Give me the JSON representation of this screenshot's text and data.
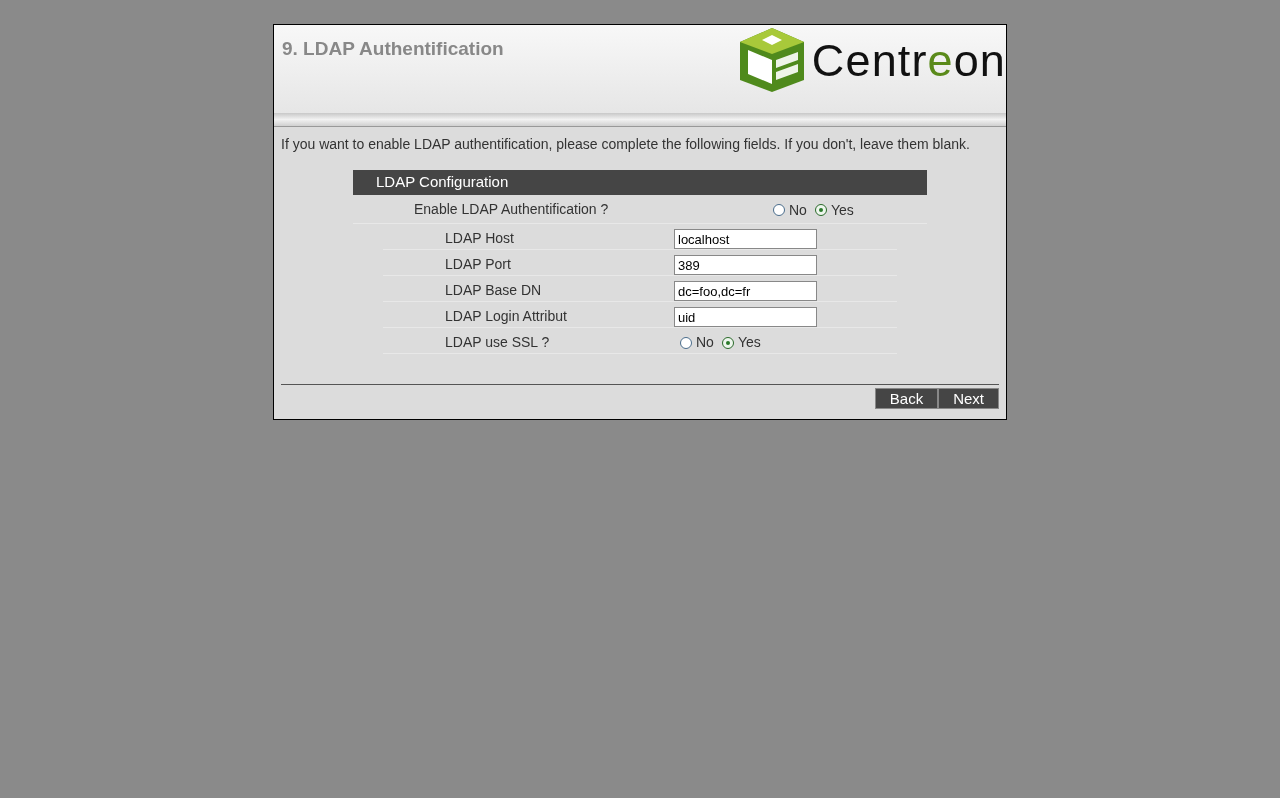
{
  "header": {
    "title": "9. LDAP Authentification",
    "logo": [
      {
        "text": "Centr",
        "color": "#111111"
      },
      {
        "text": "e",
        "color": "#5a8a1a"
      },
      {
        "text": "on",
        "color": "#111111"
      }
    ]
  },
  "intro": "If you want to enable LDAP authentification, please complete the following fields. If you don't, leave them blank.",
  "section": {
    "title": "LDAP Configuration",
    "rows": [
      {
        "kind": "radio",
        "label": "Enable LDAP Authentification ?",
        "main": true,
        "options": [
          {
            "label": "No",
            "selected": false
          },
          {
            "label": "Yes",
            "selected": true
          }
        ]
      },
      {
        "kind": "text",
        "label": "LDAP Host",
        "value": "localhost"
      },
      {
        "kind": "text",
        "label": "LDAP Port",
        "value": "389"
      },
      {
        "kind": "text",
        "label": "LDAP Base DN",
        "value": "dc=foo,dc=fr"
      },
      {
        "kind": "text",
        "label": "LDAP Login Attribut",
        "value": "uid"
      },
      {
        "kind": "radio",
        "label": "LDAP use SSL ?",
        "main": false,
        "options": [
          {
            "label": "No",
            "selected": false
          },
          {
            "label": "Yes",
            "selected": true
          }
        ]
      }
    ]
  },
  "buttons": [
    "Back",
    "Next"
  ]
}
